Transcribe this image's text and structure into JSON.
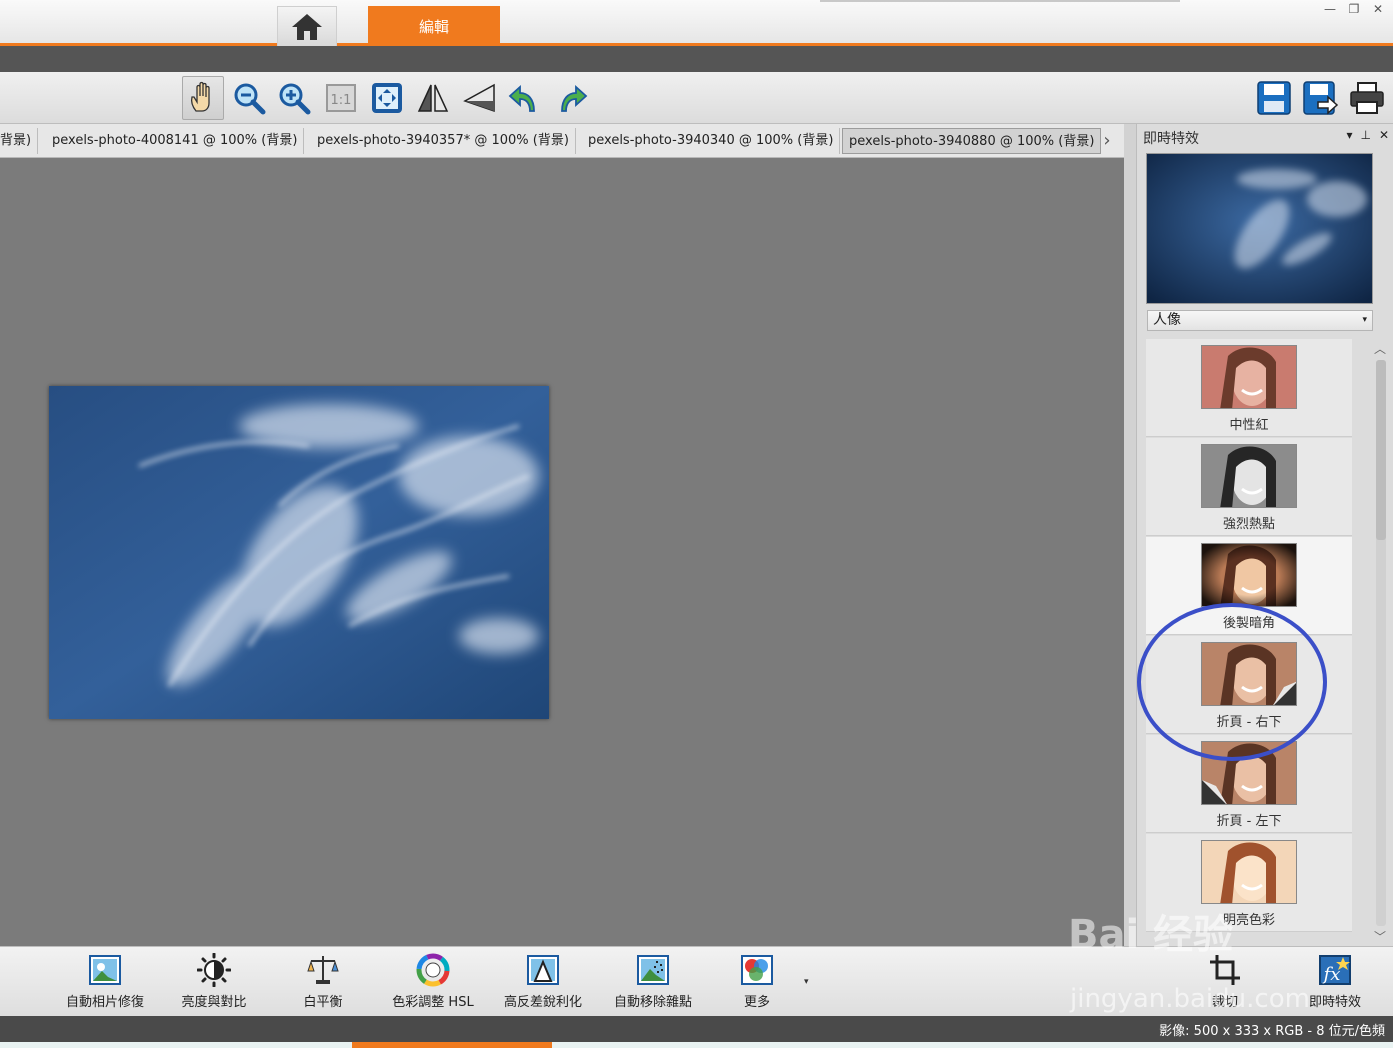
{
  "header": {
    "edit_tab": "編輯",
    "home_icon": "home-icon",
    "window_buttons": [
      "minimize-icon",
      "restore-icon",
      "close-icon"
    ]
  },
  "toolbar": {
    "tools": [
      "hand-icon",
      "zoom-out-icon",
      "zoom-in-icon",
      "actual-size-icon",
      "fit-screen-icon",
      "flip-horizontal-icon",
      "flip-vertical-icon",
      "rotate-left-icon",
      "rotate-right-icon"
    ],
    "actual_size_label": "1:1",
    "right_tools": [
      "save-icon",
      "save-as-icon",
      "print-icon"
    ]
  },
  "doc_tabs": [
    "背景)",
    "pexels-photo-4008141 @ 100% (背景)",
    "pexels-photo-3940357* @ 100% (背景)",
    "pexels-photo-3940340 @ 100% (背景)",
    "pexels-photo-3940880 @ 100% (背景)"
  ],
  "panel": {
    "title": "即時特效",
    "preset_selected": "人像",
    "effects": [
      "中性紅",
      "強烈熱點",
      "後製暗角",
      "折頁 - 右下",
      "折頁 - 左下",
      "明亮色彩"
    ]
  },
  "bottom_tools": [
    "自動相片修復",
    "亮度與對比",
    "白平衡",
    "色彩調整 HSL",
    "高反差銳利化",
    "自動移除雜點",
    "更多"
  ],
  "right_bottom": {
    "crop_label": "裁切",
    "fx_label": "即時特效"
  },
  "status": {
    "text": "影像:  500 x 333 x RGB - 8 位元/色頻"
  },
  "watermark": {
    "line1": "Bai 经验",
    "line2": "jingyan.baidu.com"
  },
  "colors": {
    "accent": "#f07a1e",
    "highlight_circle": "#3b4fc8"
  }
}
